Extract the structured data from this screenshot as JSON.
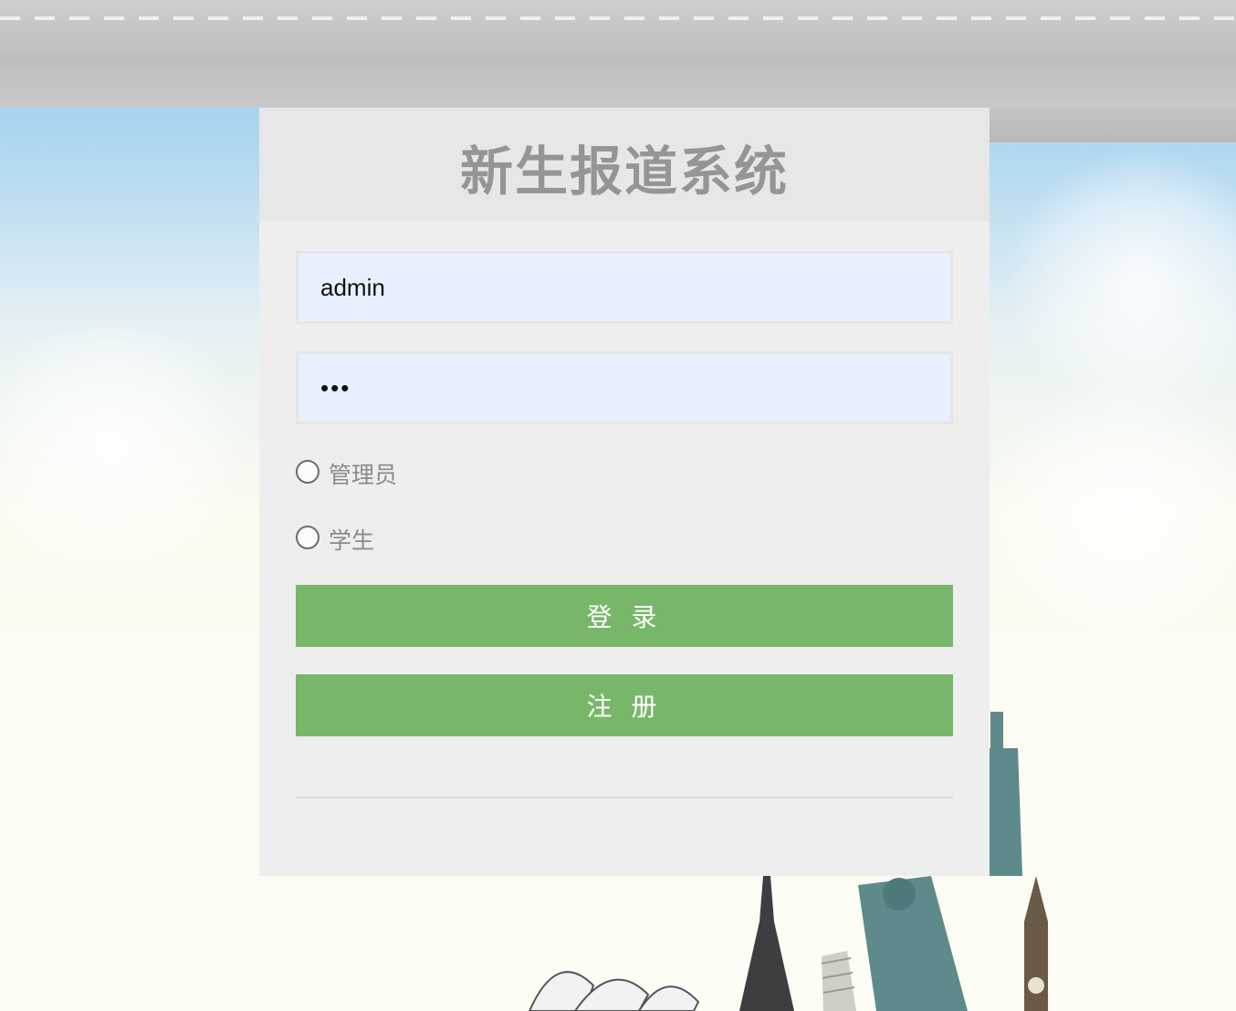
{
  "header": {
    "title": "新生报道系统"
  },
  "form": {
    "username_value": "admin",
    "password_value": "abc"
  },
  "role_options": [
    {
      "label": "管理员",
      "selected": false
    },
    {
      "label": "学生",
      "selected": false
    }
  ],
  "buttons": {
    "login_label": "登 录",
    "register_label": "注 册"
  },
  "colors": {
    "button_green": "#78b769",
    "card_bg": "#eeeeee",
    "title_gray": "#959595",
    "input_bg": "#e9f0fd"
  }
}
